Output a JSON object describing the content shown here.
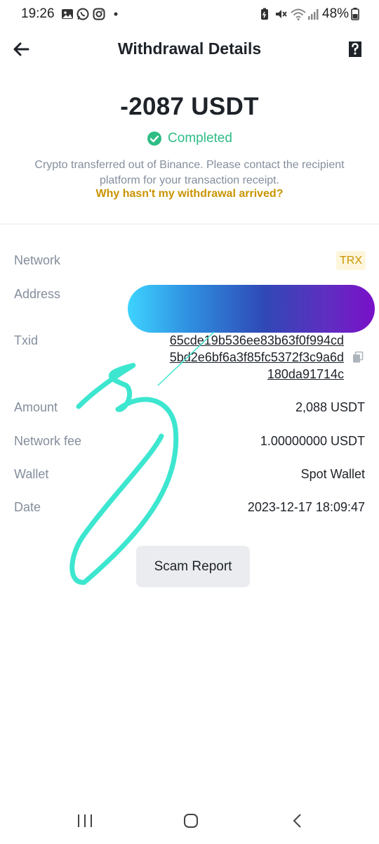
{
  "status_bar": {
    "time": "19:26",
    "battery": "48%",
    "left_icons": [
      "gallery-icon",
      "whatsapp-icon",
      "instagram-icon",
      "dot-icon"
    ],
    "right_icons": [
      "battery-saver-icon",
      "mute-icon",
      "wifi-icon",
      "signal-icon",
      "battery-icon"
    ]
  },
  "header": {
    "title": "Withdrawal Details",
    "back_icon": "arrow-left-icon",
    "help_icon": "help-document-icon"
  },
  "summary": {
    "amount": "-2087 USDT",
    "status": "Completed",
    "info_line1": "Crypto transferred out of Binance. Please contact the recipient",
    "info_line2": "platform for your transaction receipt.",
    "why_link": "Why hasn't my withdrawal arrived?"
  },
  "details": {
    "network_label": "Network",
    "network_value": "TRX",
    "address_label": "Address",
    "txid_label": "Txid",
    "txid_lines": [
      "65cde19b536ee83b63f0f994cd",
      "5bd2e6bf6a3f85fc5372f3c9a6d",
      "180da91714c"
    ],
    "amount_label": "Amount",
    "amount_value": "2,088 USDT",
    "fee_label": "Network fee",
    "fee_value": "1.00000000 USDT",
    "wallet_label": "Wallet",
    "wallet_value": "Spot Wallet",
    "date_label": "Date",
    "date_value": "2023-12-17 18:09:47"
  },
  "actions": {
    "scam_report": "Scam Report"
  },
  "colors": {
    "success": "#2ebd85",
    "accent": "#c99400",
    "muted": "#848e9c",
    "scribble": "#3de6cf"
  }
}
